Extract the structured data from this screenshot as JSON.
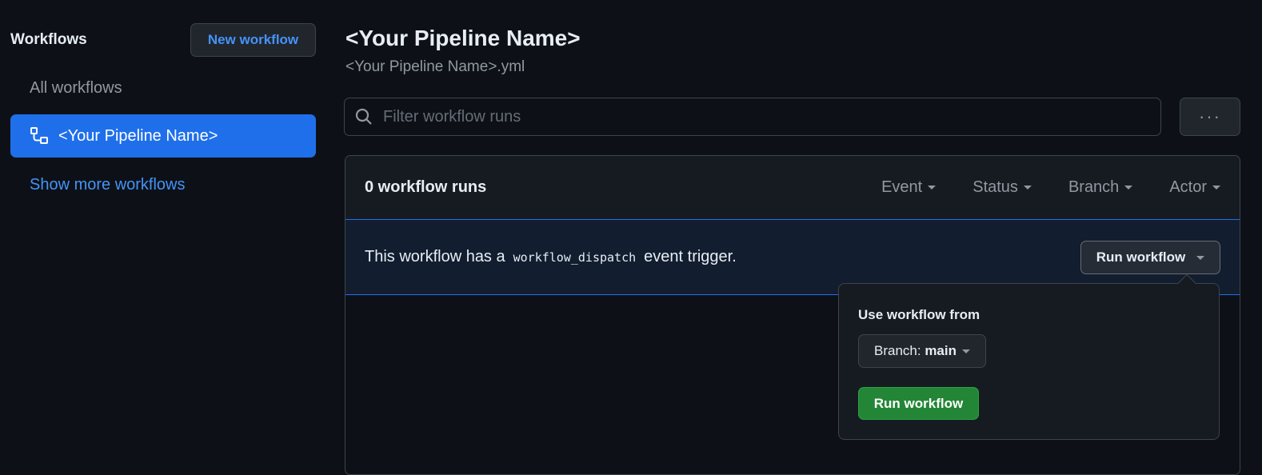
{
  "sidebar": {
    "title": "Workflows",
    "new_workflow": "New workflow",
    "all_workflows": "All workflows",
    "active_workflow": "<Your Pipeline Name>",
    "show_more": "Show more workflows"
  },
  "header": {
    "title": "<Your Pipeline Name>",
    "file": "<Your Pipeline Name>.yml"
  },
  "filter": {
    "placeholder": "Filter workflow runs",
    "value": ""
  },
  "runs": {
    "count": "0 workflow runs",
    "filters": [
      "Event",
      "Status",
      "Branch",
      "Actor"
    ]
  },
  "banner": {
    "text_before": "This workflow has a",
    "code": "workflow_dispatch",
    "text_after": "event trigger.",
    "run_button": "Run workflow"
  },
  "popup": {
    "label": "Use workflow from",
    "branch_label": "Branch:",
    "branch_value": "main",
    "submit": "Run workflow"
  },
  "colors": {
    "accent": "#1f6feb",
    "link": "#4493f8",
    "success": "#238636",
    "bg": "#0d1117"
  }
}
